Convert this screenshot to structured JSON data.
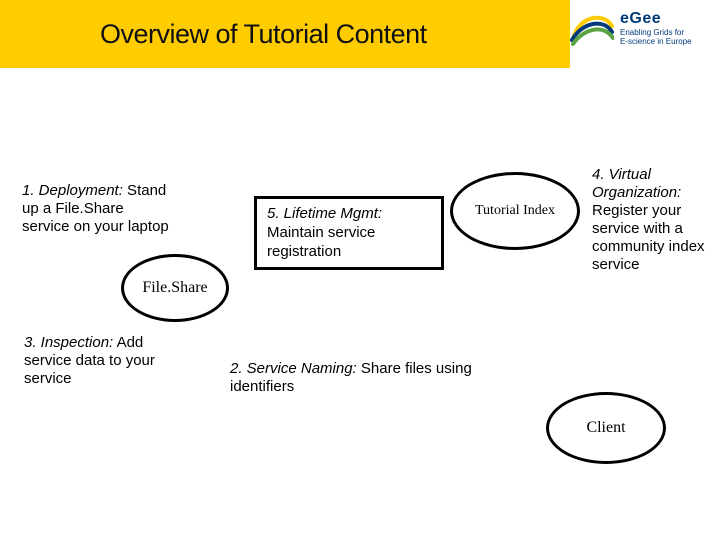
{
  "header": {
    "title": "Overview of Tutorial Content",
    "logo_name": "eGee",
    "logo_tag1": "Enabling Grids for",
    "logo_tag2": "E-science in Europe"
  },
  "annotations": {
    "a1_lead": "1. Deployment:",
    "a1_rest": " Stand up a File.Share service on your laptop",
    "a4_lead": "4. Virtual Organization:",
    "a4_rest": " Register your service with a community index service",
    "a3_lead": "3. Inspection:",
    "a3_rest": " Add service data to your service",
    "a2_lead": "2. Service Naming:",
    "a2_rest": " Share files using identifiers"
  },
  "box5": {
    "lead": "5. Lifetime Mgmt:",
    "rest": " Maintain service registration"
  },
  "ellipses": {
    "fileshare": "File.Share",
    "tutorial": "Tutorial Index",
    "client": "Client"
  }
}
